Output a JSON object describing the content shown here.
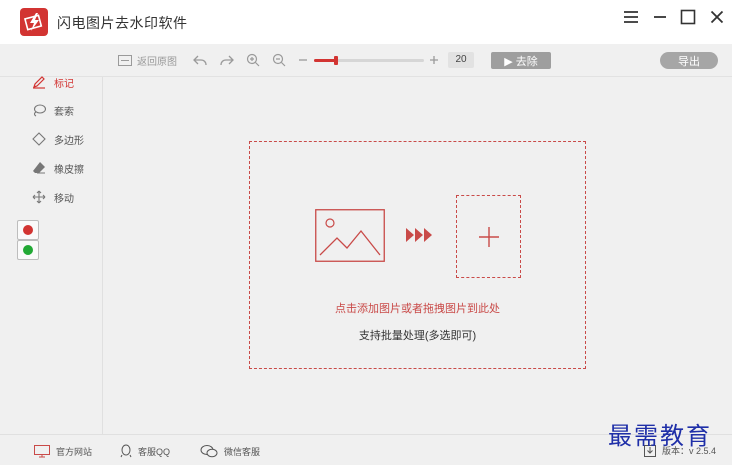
{
  "app": {
    "title": "闪电图片去水印软件",
    "colors": {
      "accent": "#d23432",
      "dashed": "#c94a48",
      "button_gray": "#9e9e9e",
      "watermark": "#1f2fa8"
    }
  },
  "window_controls": {
    "icons": [
      "menu-icon",
      "minimize-icon",
      "maximize-icon",
      "close-icon"
    ]
  },
  "toolbar": {
    "restore_label": "返回原图",
    "zoom_value": "20",
    "zoom_fraction": 0.2,
    "remove_label": "▶ 去除",
    "export_label": "导出"
  },
  "sidebar": {
    "tools": [
      {
        "label": "标记",
        "icon": "pen-icon",
        "active": true
      },
      {
        "label": "套索",
        "icon": "lasso-icon",
        "active": false
      },
      {
        "label": "多边形",
        "icon": "polygon-icon",
        "active": false
      },
      {
        "label": "橡皮擦",
        "icon": "eraser-icon",
        "active": false
      },
      {
        "label": "移动",
        "icon": "move-icon",
        "active": false
      }
    ],
    "colors": [
      "#d23432",
      "#22a935"
    ]
  },
  "dropzone": {
    "title": "点击添加图片或者拖拽图片到此处",
    "subtitle": "支持批量处理(多选即可)"
  },
  "statusbar": {
    "website_label": "官方网站",
    "qq_label": "客服QQ",
    "wechat_label": "微信客服",
    "version_label": "版本：v 2.5.4"
  },
  "watermark": "最需教育"
}
